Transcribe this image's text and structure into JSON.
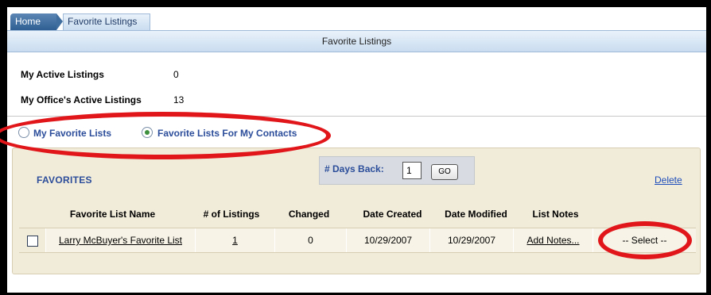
{
  "tabs": {
    "home": "Home",
    "active": "Favorite Listings"
  },
  "page_title": "Favorite Listings",
  "stats": [
    {
      "label": "My Active Listings",
      "value": "0"
    },
    {
      "label": "My Office's Active Listings",
      "value": "13"
    }
  ],
  "radios": [
    {
      "label": "My Favorite Lists",
      "checked": false
    },
    {
      "label": "Favorite Lists For My Contacts",
      "checked": true
    }
  ],
  "favorites": {
    "heading": "FAVORITES",
    "days_back_label": "# Days Back:",
    "days_back_value": "1",
    "go_label": "GO",
    "delete_label": "Delete",
    "columns": [
      "Favorite List Name",
      "# of Listings",
      "Changed",
      "Date Created",
      "Date Modified",
      "List Notes"
    ],
    "rows": [
      {
        "name": "Larry McBuyer's Favorite List",
        "listings": "1",
        "changed": "0",
        "created": "10/29/2007",
        "modified": "10/29/2007",
        "notes": "Add Notes...",
        "action": "-- Select --"
      }
    ]
  },
  "colors": {
    "accent_blue": "#2b4d9a",
    "annotation_red": "#e0161b",
    "panel_bg": "#f1ebd9"
  }
}
